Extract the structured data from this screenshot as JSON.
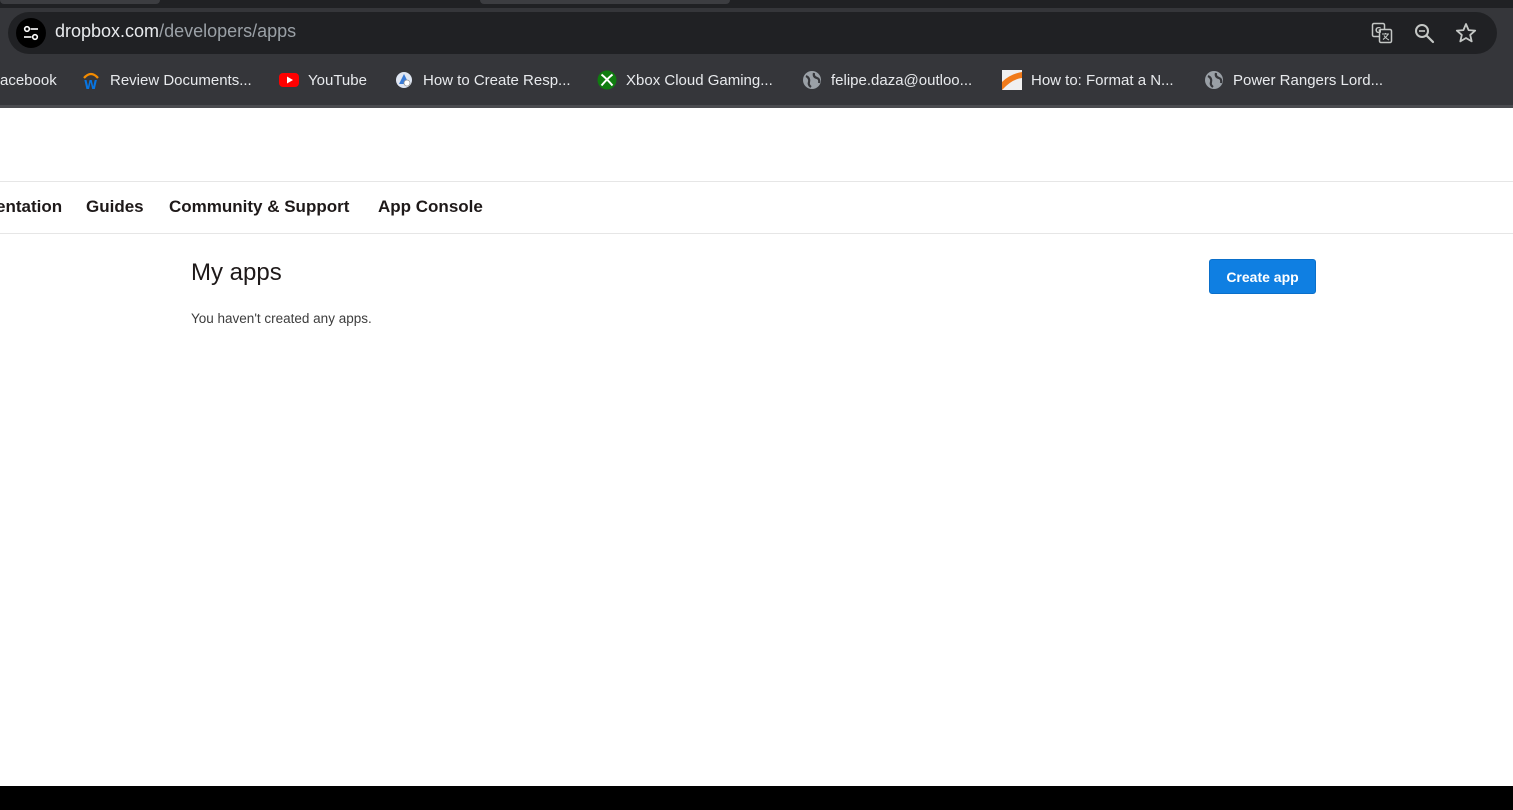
{
  "browser": {
    "url_host": "dropbox.com",
    "url_path": "/developers/apps",
    "icons": [
      "site-info-icon",
      "translate-icon",
      "zoom-icon",
      "bookmark-star-icon"
    ]
  },
  "bookmarks": [
    {
      "label": "acebook",
      "icon": "facebook-icon"
    },
    {
      "label": "Review Documents...",
      "icon": "workday-icon"
    },
    {
      "label": "YouTube",
      "icon": "youtube-icon"
    },
    {
      "label": "How to Create Resp...",
      "icon": "site-favicon"
    },
    {
      "label": "Xbox Cloud Gaming...",
      "icon": "xbox-icon"
    },
    {
      "label": "felipe.daza@outloo...",
      "icon": "globe-icon"
    },
    {
      "label": "How to: Format a N...",
      "icon": "site-favicon"
    },
    {
      "label": "Power Rangers Lord...",
      "icon": "globe-icon"
    }
  ],
  "nav": {
    "items": [
      "entation",
      "Guides",
      "Community & Support",
      "App Console"
    ]
  },
  "main": {
    "title": "My apps",
    "empty_message": "You haven't created any apps.",
    "create_button": "Create app"
  },
  "colors": {
    "accent": "#0f7fe2",
    "chrome_bg": "#35363a",
    "omnibox_bg": "#202124"
  }
}
